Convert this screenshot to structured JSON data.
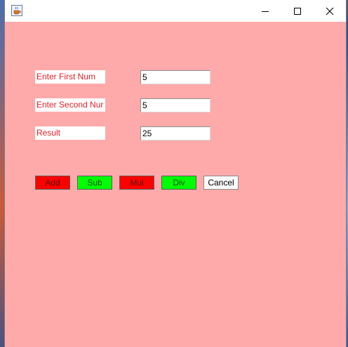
{
  "window": {
    "title": "",
    "app_icon": "java-cup-icon",
    "controls": {
      "minimize": "minimize-icon",
      "maximize": "maximize-icon",
      "close": "close-icon"
    },
    "background_color": "#ffaaaa"
  },
  "form": {
    "first": {
      "label": "Enter First Num",
      "value": "5"
    },
    "second": {
      "label": "Enter Second Nur",
      "value": "5"
    },
    "result": {
      "label": "Result",
      "value": "25"
    },
    "label_color": "#e0202a"
  },
  "buttons": {
    "add": {
      "label": "Add",
      "color": "#ff0000"
    },
    "sub": {
      "label": "Sub",
      "color": "#00ff00"
    },
    "mul": {
      "label": "Mul",
      "color": "#ff0000"
    },
    "div": {
      "label": "Div",
      "color": "#00ff00"
    },
    "cancel": {
      "label": "Cancel",
      "color": "#fbfbfb"
    }
  }
}
